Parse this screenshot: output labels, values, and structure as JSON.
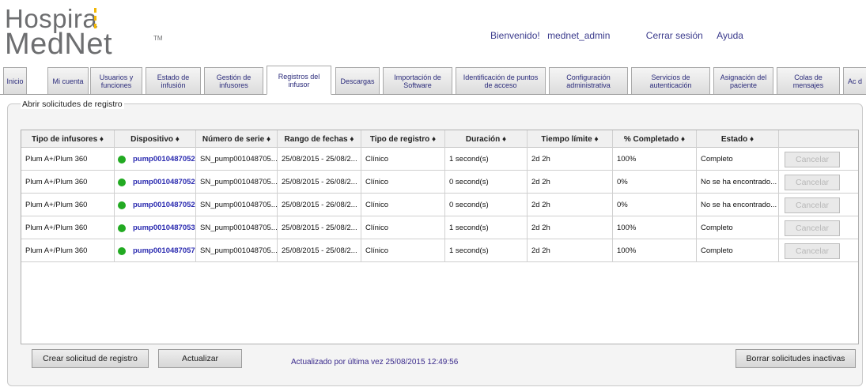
{
  "header": {
    "logo_line1": "Hospira",
    "logo_line2": "MedNet",
    "logo_tm": "TM",
    "welcome": "Bienvenido!",
    "username": "mednet_admin",
    "logout": "Cerrar sesión",
    "help": "Ayuda"
  },
  "tabs": [
    {
      "label": "Inicio"
    },
    {
      "label": "Mi cuenta"
    },
    {
      "label": "Usuarios y funciones"
    },
    {
      "label": "Estado de infusión"
    },
    {
      "label": "Gestión de infusores"
    },
    {
      "label": "Registros del infusor"
    },
    {
      "label": "Descargas"
    },
    {
      "label": "Importación de Software"
    },
    {
      "label": "Identificación de puntos de acceso"
    },
    {
      "label": "Configuración administrativa"
    },
    {
      "label": "Servicios de autenticación"
    },
    {
      "label": "Asignación del paciente"
    },
    {
      "label": "Colas de mensajes"
    },
    {
      "label": "Ac d"
    }
  ],
  "panel": {
    "legend": "Abrir solicitudes de registro",
    "columns": [
      "Tipo de infusores ♦",
      "Dispositivo ♦",
      "Número de serie ♦",
      "Rango de fechas ♦",
      "Tipo de registro ♦",
      "Duración ♦",
      "Tiempo límite ♦",
      "% Completado ♦",
      "Estado ♦",
      ""
    ],
    "rows": [
      {
        "type": "Plum A+/Plum 360",
        "device": "pump0010487052",
        "serial": "SN_pump001048705...",
        "dates": "25/08/2015 - 25/08/2...",
        "log_type": "Clínico",
        "duration": "1 second(s)",
        "limit": "2d 2h",
        "pct": "100%",
        "status": "Completo",
        "action": "Cancelar"
      },
      {
        "type": "Plum A+/Plum 360",
        "device": "pump0010487052",
        "serial": "SN_pump001048705...",
        "dates": "25/08/2015 - 26/08/2...",
        "log_type": "Clínico",
        "duration": "0 second(s)",
        "limit": "2d 2h",
        "pct": "0%",
        "status": "No se ha encontrado...",
        "action": "Cancelar"
      },
      {
        "type": "Plum A+/Plum 360",
        "device": "pump0010487052",
        "serial": "SN_pump001048705...",
        "dates": "25/08/2015 - 26/08/2...",
        "log_type": "Clínico",
        "duration": "0 second(s)",
        "limit": "2d 2h",
        "pct": "0%",
        "status": "No se ha encontrado...",
        "action": "Cancelar"
      },
      {
        "type": "Plum A+/Plum 360",
        "device": "pump0010487053",
        "serial": "SN_pump001048705...",
        "dates": "25/08/2015 - 25/08/2...",
        "log_type": "Clínico",
        "duration": "1 second(s)",
        "limit": "2d 2h",
        "pct": "100%",
        "status": "Completo",
        "action": "Cancelar"
      },
      {
        "type": "Plum A+/Plum 360",
        "device": "pump0010487057",
        "serial": "SN_pump001048705...",
        "dates": "25/08/2015 - 25/08/2...",
        "log_type": "Clínico",
        "duration": "1 second(s)",
        "limit": "2d 2h",
        "pct": "100%",
        "status": "Completo",
        "action": "Cancelar"
      }
    ],
    "create_button": "Crear solicitud de registro",
    "refresh_button": "Actualizar",
    "updated_text": "Actualizado por última vez 25/08/2015 12:49:56",
    "clear_button": "Borrar solicitudes inactivas"
  },
  "colors": {
    "status_dot": "#22aa22",
    "link": "#2b2bb0",
    "logo_gray": "#6d6e70",
    "logo_accent": "#f2b705"
  }
}
